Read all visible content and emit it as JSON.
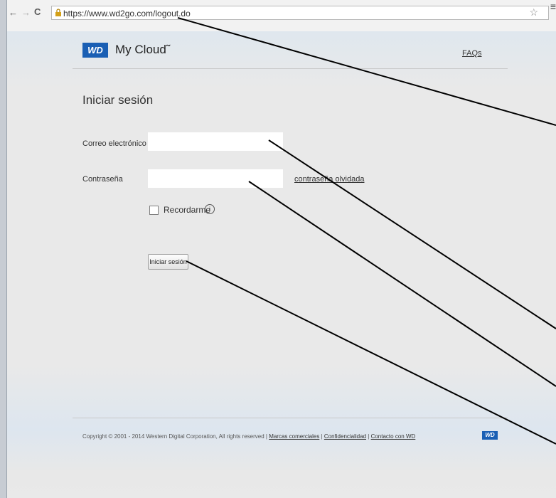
{
  "browser": {
    "back_glyph": "←",
    "forward_glyph": "→",
    "reload_glyph": "C",
    "url": "https://www.wd2go.com/logout.do",
    "star_glyph": "☆",
    "menu_glyph": "≡"
  },
  "header": {
    "logo_text": "WD",
    "brand": "My Cloud˜",
    "faq": "FAQs"
  },
  "login": {
    "title": "Iniciar sesión",
    "email_label": "Correo electrónico",
    "email_value": "",
    "password_label": "Contraseña",
    "password_value": "",
    "forgot_link": "contraseña olvidada",
    "remember_label": "Recordarme",
    "info_glyph": "i",
    "submit_label": "Iniciar sesión"
  },
  "footer": {
    "copyright": "Copyright © 2001 - 2014 Western Digital Corporation, All rights reserved |",
    "trademarks": "Marcas comerciales",
    "sep1": "|",
    "privacy": "Confidencialidad",
    "sep2": "|",
    "contact": "Contacto con WD",
    "logo_text": "WD"
  },
  "colors": {
    "brand_blue": "#1a5fb4",
    "page_background": "#e9e9e9"
  }
}
